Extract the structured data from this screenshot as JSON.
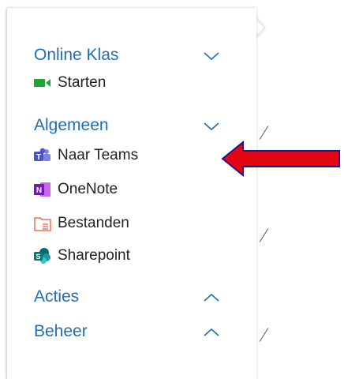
{
  "menu": {
    "sections": [
      {
        "title": "Online Klas",
        "state": "expanded",
        "chevron_icon": "chevron-down-icon",
        "items": [
          {
            "label": "Starten",
            "icon": "video-camera-icon"
          }
        ]
      },
      {
        "title": "Algemeen",
        "state": "expanded",
        "chevron_icon": "chevron-down-icon",
        "items": [
          {
            "label": "Naar Teams",
            "icon": "teams-icon"
          },
          {
            "label": "OneNote",
            "icon": "onenote-icon"
          },
          {
            "label": "Bestanden",
            "icon": "folder-icon"
          },
          {
            "label": "Sharepoint",
            "icon": "sharepoint-icon"
          }
        ]
      },
      {
        "title": "Acties",
        "state": "collapsed",
        "chevron_icon": "chevron-up-icon",
        "items": []
      },
      {
        "title": "Beheer",
        "state": "collapsed",
        "chevron_icon": "chevron-up-icon",
        "items": []
      }
    ]
  },
  "annotation": {
    "icon": "red-arrow-icon",
    "points_to": "Naar Teams",
    "color": "#e30613"
  },
  "colors": {
    "section_title": "#1e6fb5",
    "item_text": "#222222"
  }
}
